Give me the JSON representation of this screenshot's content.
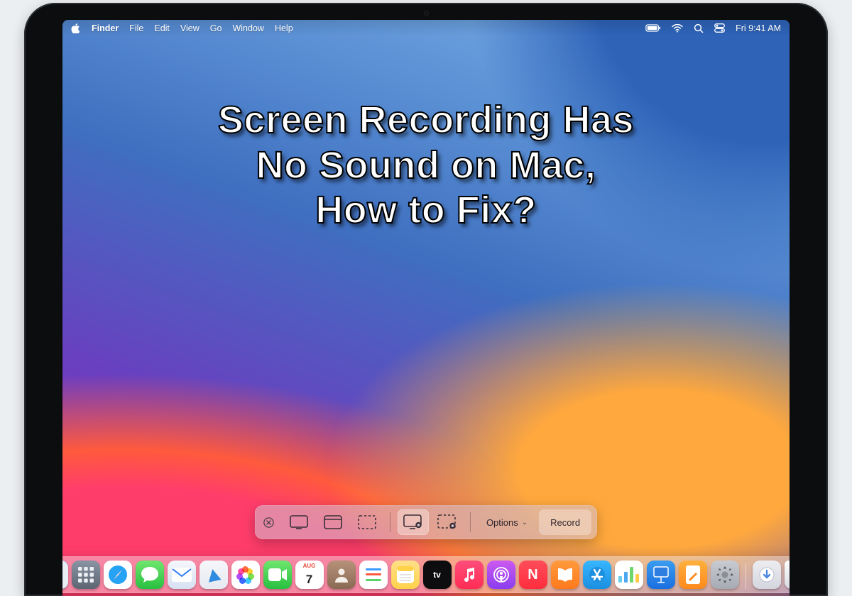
{
  "menubar": {
    "app": "Finder",
    "items": [
      "File",
      "Edit",
      "View",
      "Go",
      "Window",
      "Help"
    ],
    "clock": "Fri 9:41 AM"
  },
  "headline": "Screen Recording Has\nNo Sound on Mac,\nHow to Fix?",
  "screenshot_toolbar": {
    "options_label": "Options",
    "record_label": "Record"
  },
  "calendar": {
    "month": "AUG",
    "day": "7"
  },
  "dock_items": [
    "finder",
    "launchpad",
    "safari",
    "messages",
    "mail",
    "maps",
    "photos",
    "facetime",
    "calendar",
    "contacts",
    "reminders",
    "notes",
    "tv",
    "music",
    "podcasts",
    "news",
    "books",
    "appstore",
    "numbers",
    "keynote",
    "pages",
    "system-preferences",
    "downloads",
    "trash"
  ]
}
